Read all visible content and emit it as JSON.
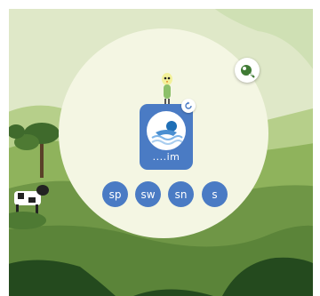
{
  "word_card": {
    "word": "....im",
    "picture_icon": "swimmer-icon"
  },
  "options": [
    "sp",
    "sw",
    "sn",
    "s"
  ],
  "icons": {
    "mascot": "bird-mascot-icon",
    "refresh": "refresh-icon",
    "corner": "leaf-sound-icon"
  },
  "colors": {
    "accent": "#4a7bc4",
    "panel": "#f4f6e3",
    "grass": "#6f9646"
  }
}
